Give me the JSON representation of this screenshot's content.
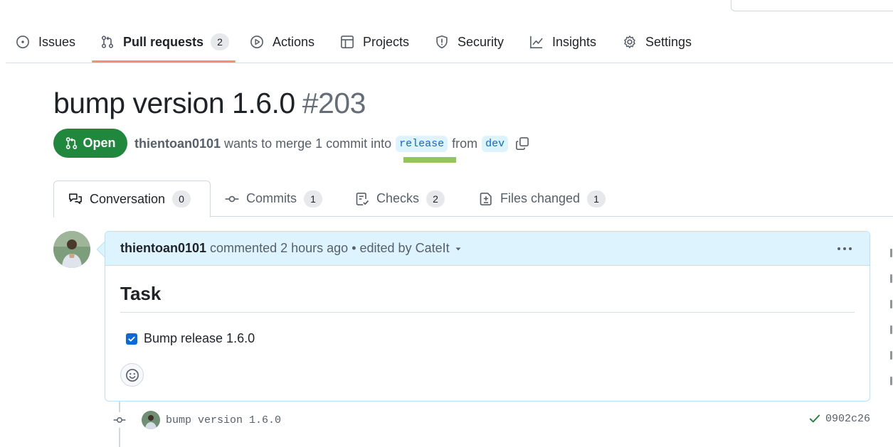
{
  "nav": {
    "items": [
      {
        "label": "Issues",
        "icon": "issue-opened-icon"
      },
      {
        "label": "Pull requests",
        "icon": "git-pull-request-icon",
        "count": "2",
        "selected": true
      },
      {
        "label": "Actions",
        "icon": "play-icon"
      },
      {
        "label": "Projects",
        "icon": "table-icon"
      },
      {
        "label": "Security",
        "icon": "shield-icon"
      },
      {
        "label": "Insights",
        "icon": "graph-icon"
      },
      {
        "label": "Settings",
        "icon": "gear-icon"
      }
    ]
  },
  "pr": {
    "title": "bump version 1.6.0",
    "number": "#203",
    "state": "Open",
    "author": "thientoan0101",
    "merge_text": "wants to merge 1 commit into",
    "base_branch": "release",
    "from_text": "from",
    "head_branch": "dev"
  },
  "tabs": [
    {
      "label": "Conversation",
      "count": "0",
      "icon": "comment-discussion-icon",
      "active": true
    },
    {
      "label": "Commits",
      "count": "1",
      "icon": "git-commit-icon"
    },
    {
      "label": "Checks",
      "count": "2",
      "icon": "checklist-icon"
    },
    {
      "label": "Files changed",
      "count": "1",
      "icon": "file-diff-icon"
    }
  ],
  "comment": {
    "author": "thientoan0101",
    "action": "commented",
    "time": "2 hours ago",
    "separator": "•",
    "edited": "edited by CateIt",
    "heading": "Task",
    "task_label": "Bump release 1.6.0",
    "task_checked": true
  },
  "commit": {
    "message": "bump version 1.6.0",
    "sha": "0902c26",
    "status": "success"
  },
  "colors": {
    "open_green": "#1f883d",
    "link_blue": "#0969da",
    "branch_bg": "#ddf4ff",
    "nav_underline": "#fd8c73",
    "highlight": "#92c55a"
  }
}
